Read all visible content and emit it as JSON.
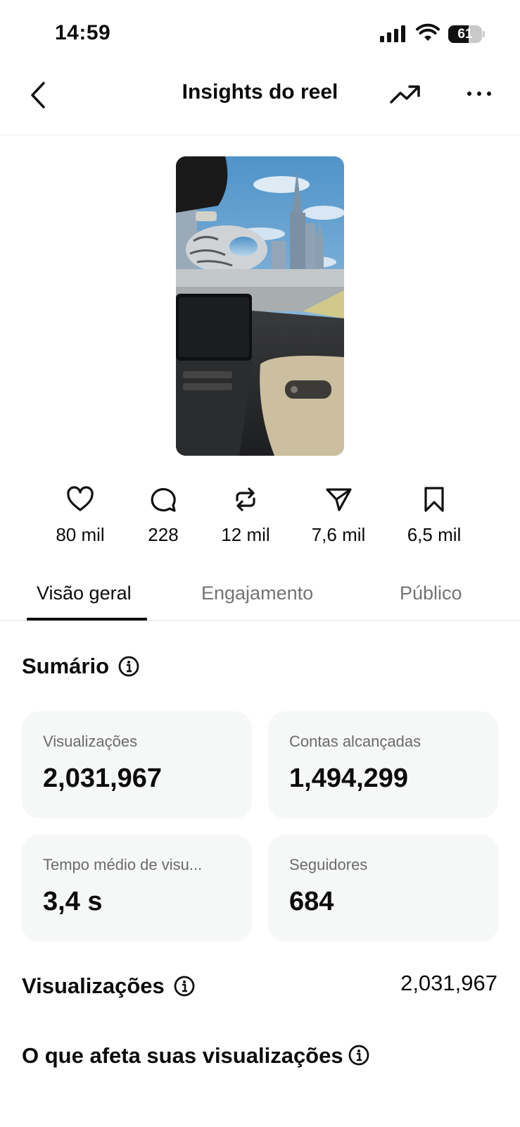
{
  "status_bar": {
    "time": "14:59",
    "battery": "61",
    "battery_level": 0.61
  },
  "nav": {
    "title": "Insights do reel"
  },
  "stats": [
    {
      "icon": "heart-icon",
      "value": "80 mil"
    },
    {
      "icon": "comment-icon",
      "value": "228"
    },
    {
      "icon": "repost-icon",
      "value": "12 mil"
    },
    {
      "icon": "share-icon",
      "value": "7,6 mil"
    },
    {
      "icon": "save-icon",
      "value": "6,5 mil"
    }
  ],
  "tabs": [
    {
      "label": "Visão geral",
      "active": true
    },
    {
      "label": "Engajamento",
      "active": false
    },
    {
      "label": "Público",
      "active": false
    }
  ],
  "summary": {
    "title": "Sumário",
    "cards": [
      {
        "label": "Visualizações",
        "value": "2,031,967"
      },
      {
        "label": "Contas alcançadas",
        "value": "1,494,299"
      },
      {
        "label": "Tempo médio de visu...",
        "value": "3,4 s"
      },
      {
        "label": "Seguidores",
        "value": "684"
      }
    ]
  },
  "views": {
    "title": "Visualizações",
    "total": "2,031,967"
  },
  "affects": {
    "title": "O que afeta suas visualizações"
  }
}
